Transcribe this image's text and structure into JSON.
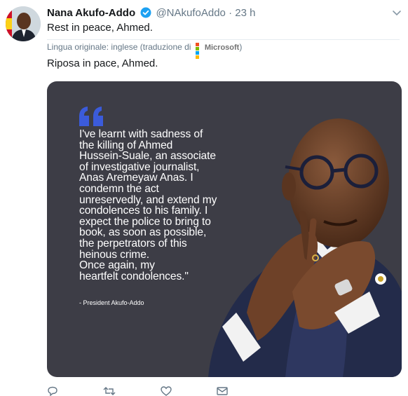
{
  "tweet": {
    "author_name": "Nana Akufo-Addo",
    "handle": "@NAkufoAddo",
    "separator": "·",
    "time": "23 h",
    "text": "Rest in peace, Ahmed.",
    "translation_note": "Lingua originale: inglese (traduzione di",
    "translation_provider": "Microsoft",
    "translation_note_end": ")",
    "translated_text": "Riposa in pace, Ahmed."
  },
  "media": {
    "quote": "I've learnt with sadness of\nthe killing of Ahmed\nHussein-Suale, an associate\nof investigative journalist,\nAnas Aremeyaw Anas. I\ncondemn the act\nunreservedly, and extend my\ncondolences to his family. I\nexpect the police to bring to\nbook, as soon as possible,\nthe perpetrators of this\nheinous crime.\nOnce again, my\nheartfelt condolences.\"",
    "attribution": "- President Akufo-Addo"
  },
  "colors": {
    "quote_mark": "#3b5bdb",
    "media_bg": "#3d3d46",
    "verified": "#1da1f2",
    "muted": "#657786"
  },
  "icons": {
    "verified": "verified-badge-icon",
    "caret": "chevron-down-icon",
    "reply": "reply-icon",
    "retweet": "retweet-icon",
    "like": "heart-icon",
    "dm": "direct-message-icon"
  }
}
